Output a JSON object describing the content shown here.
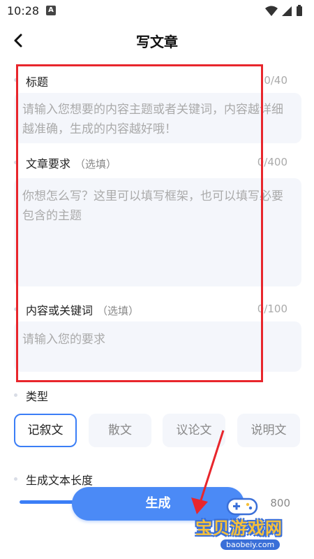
{
  "status_bar": {
    "time": "10:28",
    "notification_badge": "A"
  },
  "header": {
    "title": "写文章"
  },
  "form": {
    "title_field": {
      "label": "标题",
      "counter": "0/40",
      "placeholder": "请输入您想要的内容主题或者关键词，内容越详细越准确，生成的内容越好哦！"
    },
    "requirements_field": {
      "label": "文章要求",
      "optional": "（选填）",
      "counter": "0/400",
      "placeholder": "你想怎么写？这里可以填写框架，也可以填写必要包含的主题"
    },
    "keywords_field": {
      "label": "内容或关键词",
      "optional": "（选填）",
      "counter": "0/100",
      "placeholder": "请输入您的要求"
    }
  },
  "type_section": {
    "label": "类型",
    "options": [
      "记叙文",
      "散文",
      "议论文",
      "说明文"
    ],
    "selected": "记叙文"
  },
  "length_section": {
    "label": "生成文本长度",
    "max_value": "800"
  },
  "generate_button": {
    "label": "生成"
  },
  "watermark": {
    "text": "宝贝游戏网",
    "url": "baobeiy.com"
  },
  "colors": {
    "accent": "#3b7ef6",
    "button": "#4b8af6",
    "highlight_box": "#e8262c",
    "field_bg": "#f4f6fb"
  }
}
